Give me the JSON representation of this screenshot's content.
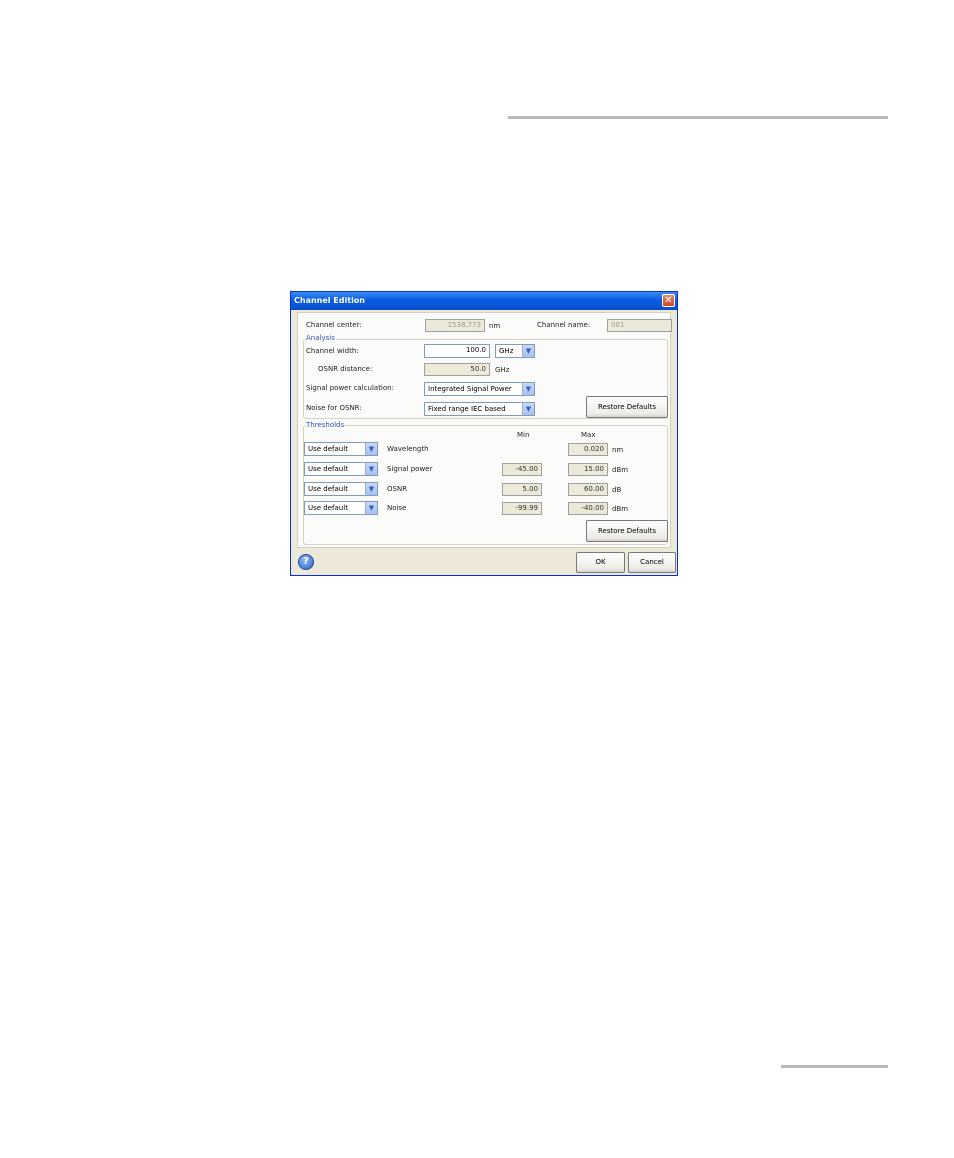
{
  "dialog": {
    "title": "Channel Edition",
    "close_glyph": "✕",
    "help_glyph": "?"
  },
  "channel": {
    "center_label": "Channel center:",
    "center_value": "1538.773",
    "center_unit": "nm",
    "name_label": "Channel name:",
    "name_value": "001"
  },
  "analysis": {
    "legend": "Analysis",
    "width_label": "Channel width:",
    "width_value": "100.0",
    "width_unit_selected": "GHz",
    "osnr_distance_label": "OSNR distance:",
    "osnr_distance_value": "50.0",
    "osnr_distance_unit": "GHz",
    "signal_power_label": "Signal power calculation:",
    "signal_power_selected": "Integrated Signal Power",
    "noise_label": "Noise for OSNR:",
    "noise_selected": "Fixed range IEC based",
    "restore_label": "Restore Defaults"
  },
  "thresholds": {
    "legend": "Thresholds",
    "min_header": "Min",
    "max_header": "Max",
    "rows": [
      {
        "mode": "Use default",
        "name": "Wavelength",
        "min": "",
        "max": "0.020",
        "unit": "nm"
      },
      {
        "mode": "Use default",
        "name": "Signal power",
        "min": "-45.00",
        "max": "15.00",
        "unit": "dBm"
      },
      {
        "mode": "Use default",
        "name": "OSNR",
        "min": "5.00",
        "max": "60.00",
        "unit": "dB"
      },
      {
        "mode": "Use default",
        "name": "Noise",
        "min": "-99.99",
        "max": "-40.00",
        "unit": "dBm"
      }
    ],
    "restore_label": "Restore Defaults"
  },
  "footer": {
    "ok_label": "OK",
    "cancel_label": "Cancel"
  },
  "icons": {
    "combo_arrow": "chevron-down-icon",
    "help": "help-icon",
    "close": "close-icon"
  }
}
